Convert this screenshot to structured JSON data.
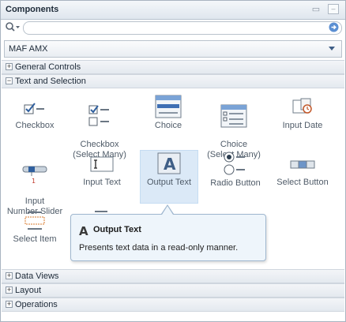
{
  "panel": {
    "title": "Components",
    "minimize_glyph": "▭",
    "close_glyph": "□"
  },
  "search": {
    "placeholder": ""
  },
  "library": {
    "selected": "MAF AMX"
  },
  "sections": {
    "general_controls": "General Controls",
    "text_and_selection": "Text and Selection",
    "data_views": "Data Views",
    "layout": "Layout",
    "operations": "Operations"
  },
  "items": [
    {
      "label": "Checkbox",
      "icon": "checkbox-icon"
    },
    {
      "label": "Checkbox\n(Select Many)",
      "icon": "checkbox-select-many-icon"
    },
    {
      "label": "Choice",
      "icon": "choice-icon"
    },
    {
      "label": "Choice\n(Select Many)",
      "icon": "choice-select-many-icon"
    },
    {
      "label": "Input Date",
      "icon": "input-date-icon"
    },
    {
      "label": "Input\nNumber Slider",
      "icon": "input-number-slider-icon"
    },
    {
      "label": "Input Text",
      "icon": "input-text-icon"
    },
    {
      "label": "Output Text",
      "icon": "output-text-icon",
      "selected": true
    },
    {
      "label": "Radio Button",
      "icon": "radio-button-icon"
    },
    {
      "label": "Select Button",
      "icon": "select-button-icon"
    },
    {
      "label": "Select Item",
      "icon": "select-item-icon"
    }
  ],
  "tooltip": {
    "title": "Output Text",
    "description": "Presents text data in a read-only manner."
  },
  "colors": {
    "accent": "#3f6fb4",
    "selected_bg": "#dbe9f7",
    "tooltip_bg": "#eef5fb"
  }
}
